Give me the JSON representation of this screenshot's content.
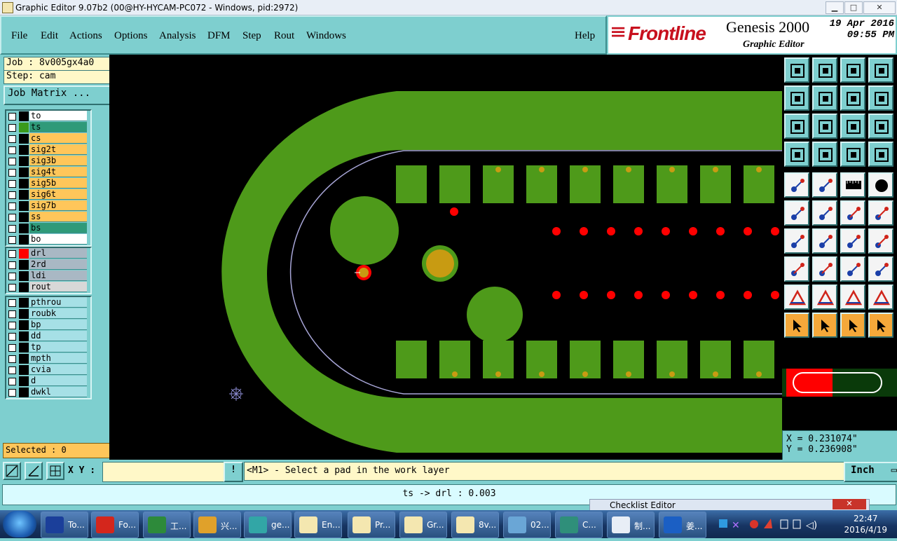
{
  "window": {
    "title": "Graphic Editor 9.07b2 (00@HY-HYCAM-PC072 - Windows, pid:2972)"
  },
  "menu": {
    "items": [
      {
        "label": "File"
      },
      {
        "label": "Edit"
      },
      {
        "label": "Actions"
      },
      {
        "label": "Options"
      },
      {
        "label": "Analysis"
      },
      {
        "label": "DFM"
      },
      {
        "label": "Step"
      },
      {
        "label": "Rout"
      },
      {
        "label": "Windows"
      }
    ],
    "help": "Help"
  },
  "brand": {
    "logo": "Frontline",
    "product": "Genesis 2000",
    "subtitle": "Graphic Editor",
    "date": "19 Apr 2016",
    "time": "09:55 PM"
  },
  "job": {
    "job_label": "Job : 8v005gx4a0",
    "step_label": "Step: cam",
    "matrix_button": "Job Matrix ..."
  },
  "layers_board": [
    {
      "name": "to",
      "bg": "#ffffff",
      "swatch": "#000000"
    },
    {
      "name": "ts",
      "bg": "#2f9a79",
      "swatch": "#3a9a1c"
    },
    {
      "name": "cs",
      "bg": "#ffc65a",
      "swatch": "#000000"
    },
    {
      "name": "sig2t",
      "bg": "#ffc65a",
      "swatch": "#000000"
    },
    {
      "name": "sig3b",
      "bg": "#ffc65a",
      "swatch": "#000000"
    },
    {
      "name": "sig4t",
      "bg": "#ffc65a",
      "swatch": "#000000"
    },
    {
      "name": "sig5b",
      "bg": "#ffc65a",
      "swatch": "#000000"
    },
    {
      "name": "sig6t",
      "bg": "#ffc65a",
      "swatch": "#000000"
    },
    {
      "name": "sig7b",
      "bg": "#ffc65a",
      "swatch": "#000000"
    },
    {
      "name": "ss",
      "bg": "#ffc65a",
      "swatch": "#000000"
    },
    {
      "name": "bs",
      "bg": "#2f9a79",
      "swatch": "#000000"
    },
    {
      "name": "bo",
      "bg": "#ffffff",
      "swatch": "#000000"
    }
  ],
  "layers_drill": [
    {
      "name": "drl",
      "bg": "#a9b8c4",
      "swatch": "#ff0000"
    },
    {
      "name": "2rd",
      "bg": "#a9b8c4",
      "swatch": "#000000"
    },
    {
      "name": "ldi",
      "bg": "#a9b8c4",
      "swatch": "#000000"
    },
    {
      "name": "rout",
      "bg": "#d8d8d8",
      "swatch": "#000000"
    }
  ],
  "layers_misc": [
    {
      "name": "pthrou",
      "bg": "#a6e0e6",
      "swatch": "#000000"
    },
    {
      "name": "roubk",
      "bg": "#a6e0e6",
      "swatch": "#000000"
    },
    {
      "name": "bp",
      "bg": "#a6e0e6",
      "swatch": "#000000"
    },
    {
      "name": "dd",
      "bg": "#a6e0e6",
      "swatch": "#000000"
    },
    {
      "name": "tp",
      "bg": "#a6e0e6",
      "swatch": "#000000"
    },
    {
      "name": "mpth",
      "bg": "#a6e0e6",
      "swatch": "#000000"
    },
    {
      "name": "cvia",
      "bg": "#a6e0e6",
      "swatch": "#000000"
    },
    {
      "name": "d",
      "bg": "#a6e0e6",
      "swatch": "#000000"
    },
    {
      "name": "dwkl",
      "bg": "#a6e0e6",
      "swatch": "#000000"
    }
  ],
  "selected": "Selected : 0",
  "coords": {
    "x": "X = 0.231074\"",
    "y": "Y = 0.236908\""
  },
  "status": {
    "xy_label": "X Y :",
    "xy_value": "",
    "message": "<M1> - Select a pad in the work layer",
    "unit": "Inch",
    "info": "ts -> drl : 0.003"
  },
  "checklist_title": "Checklist Editor",
  "colors": {
    "copper": "#4e9a1a",
    "pad_gold": "#c89b12",
    "drill": "#ff0000",
    "panel": "#7ecfcf"
  },
  "taskbar": {
    "items": [
      {
        "label": "To...",
        "icon": "#1b3f9a"
      },
      {
        "label": "Fo...",
        "icon": "#d4261c"
      },
      {
        "label": "工...",
        "icon": "#2d8a3a"
      },
      {
        "label": "兴...",
        "icon": "#e0a12a"
      },
      {
        "label": "ge...",
        "icon": "#32a6a6"
      },
      {
        "label": "En...",
        "icon": "#f4e7b0"
      },
      {
        "label": "Pr...",
        "icon": "#f4e7b0"
      },
      {
        "label": "Gr...",
        "icon": "#f4e7b0"
      },
      {
        "label": "8v...",
        "icon": "#f4e7b0"
      },
      {
        "label": "02...",
        "icon": "#6aa6d6"
      },
      {
        "label": "C...",
        "icon": "#2f8f7a"
      },
      {
        "label": "制...",
        "icon": "#e8eef6"
      },
      {
        "label": "姜...",
        "icon": "#1b5fc4"
      }
    ],
    "time": "22:47",
    "date": "2016/4/19"
  }
}
